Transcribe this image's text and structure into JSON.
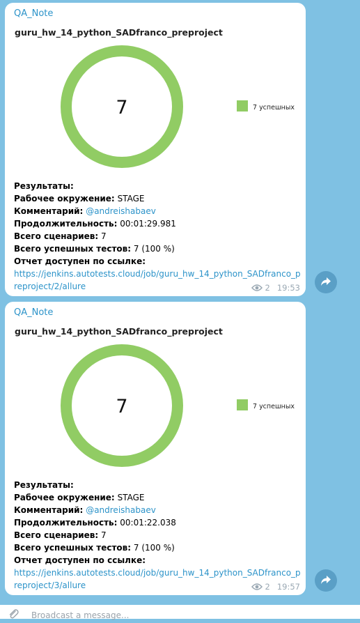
{
  "messages": [
    {
      "sender": "QA_Note",
      "chart_data": {
        "type": "pie",
        "title": "guru_hw_14_python_SADfranco_preproject",
        "center_label": "7",
        "slices": [
          {
            "label": "7 успешных",
            "value": 7,
            "color": "#91cc64"
          }
        ],
        "legend_position": "right"
      },
      "results_label": "Результаты:",
      "env_label": "Рабочее окружение:",
      "env_value": "STAGE",
      "comment_label": "Комментарий:",
      "comment_value": "@andreishabaev",
      "duration_label": "Продолжительность:",
      "duration_value": "00:01:29.981",
      "scenarios_label": "Всего сценариев:",
      "scenarios_value": "7",
      "passed_label": "Всего успешных тестов:",
      "passed_value": "7 (100 %)",
      "report_label": "Отчет доступен по ссылке:",
      "report_link": "https://jenkins.autotests.cloud/job/guru_hw_14_python_SADfranco_preproject/2/allure",
      "views": "2",
      "time": "19:53"
    },
    {
      "sender": "QA_Note",
      "chart_data": {
        "type": "pie",
        "title": "guru_hw_14_python_SADfranco_preproject",
        "center_label": "7",
        "slices": [
          {
            "label": "7 успешных",
            "value": 7,
            "color": "#91cc64"
          }
        ],
        "legend_position": "right"
      },
      "results_label": "Результаты:",
      "env_label": "Рабочее окружение:",
      "env_value": "STAGE",
      "comment_label": "Комментарий:",
      "comment_value": "@andreishabaev",
      "duration_label": "Продолжительность:",
      "duration_value": "00:01:22.038",
      "scenarios_label": "Всего сценариев:",
      "scenarios_value": "7",
      "passed_label": "Всего успешных тестов:",
      "passed_value": "7 (100 %)",
      "report_label": "Отчет доступен по ссылке:",
      "report_link": "https://jenkins.autotests.cloud/job/guru_hw_14_python_SADfranco_preproject/3/allure",
      "views": "2",
      "time": "19:57"
    }
  ],
  "composer": {
    "placeholder": "Broadcast a message..."
  },
  "icons": {
    "attach": "paperclip-icon",
    "views": "eye-icon",
    "share": "share-arrow-icon"
  },
  "colors": {
    "background": "#7fc1e3",
    "link": "#2c93c9",
    "success": "#91cc64"
  }
}
